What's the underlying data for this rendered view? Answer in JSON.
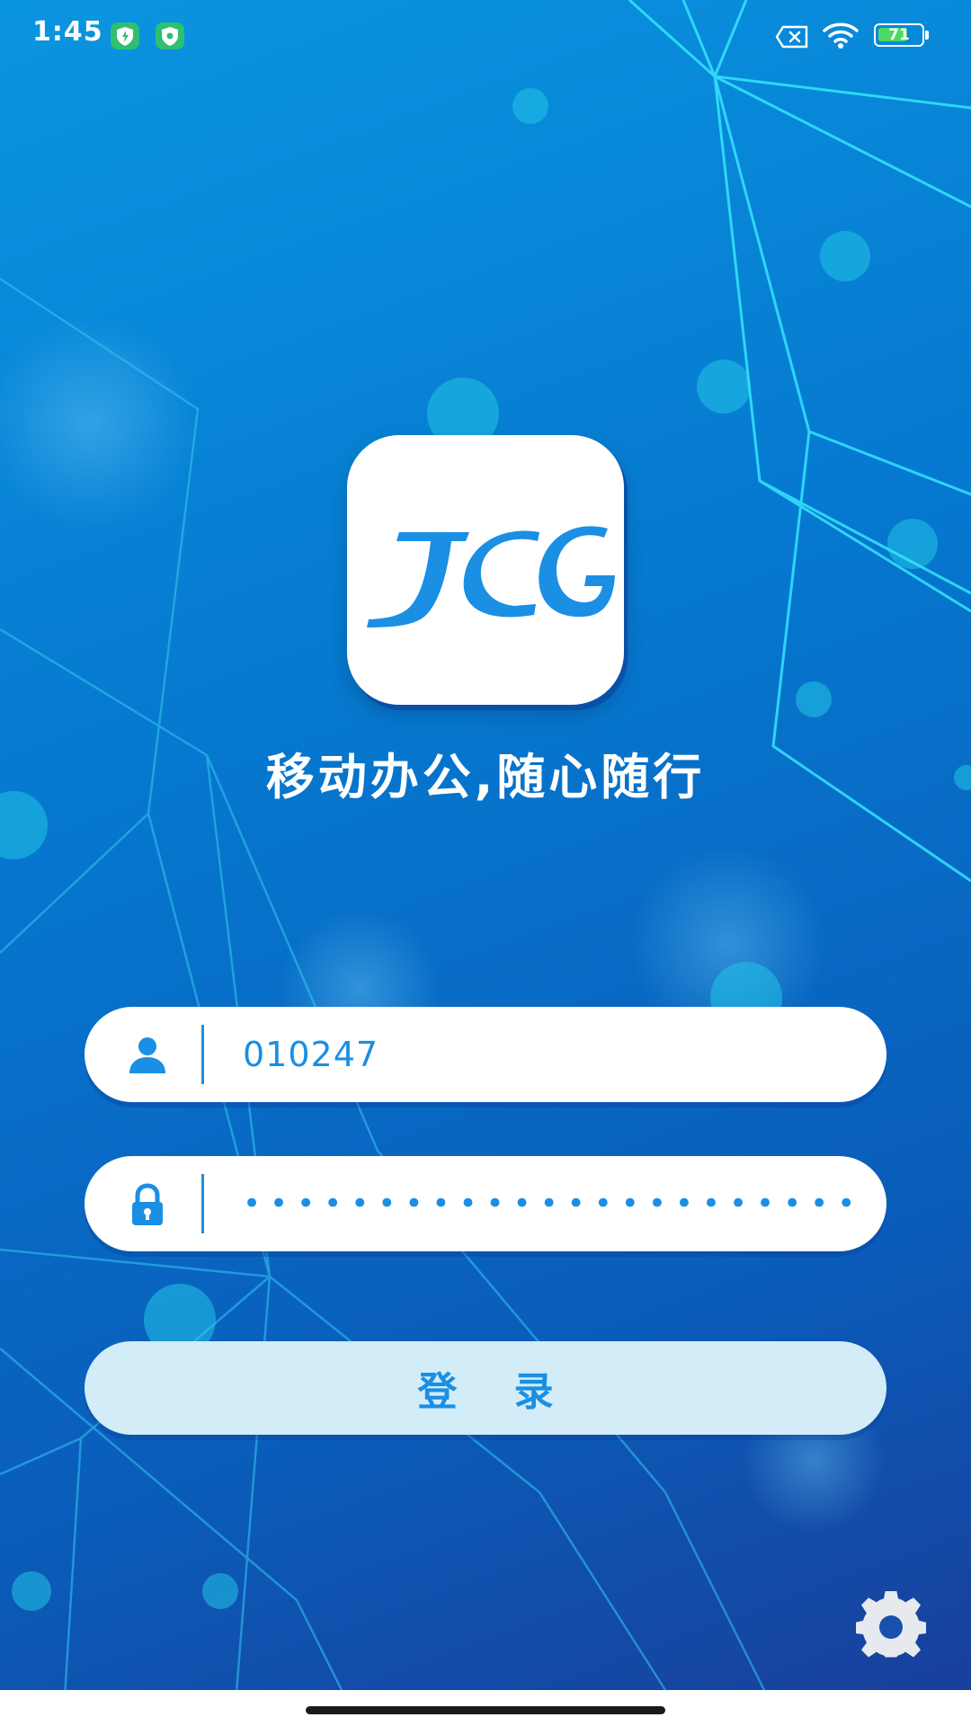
{
  "status_bar": {
    "time": "1:45",
    "battery_level": "71",
    "battery_fraction": 0.71,
    "icons": [
      "shield-icon",
      "shield-icon",
      "sim-off-icon",
      "wifi-icon",
      "battery-icon"
    ]
  },
  "app": {
    "logo_text": "JCG",
    "slogan": "移动办公,随心随行"
  },
  "login_form": {
    "username": {
      "icon": "user-icon",
      "value": "010247"
    },
    "password": {
      "icon": "lock-icon",
      "value": "••••••••••••••••••••••••••"
    },
    "login_button_label": "登 录"
  },
  "settings": {
    "icon": "gear-icon"
  },
  "colors": {
    "accent": "#1a8fe3",
    "background_top": "#0a95e0",
    "background_bottom": "#1a3d9a",
    "button_fill": "#d2ecf8",
    "battery": "#4cd964"
  }
}
